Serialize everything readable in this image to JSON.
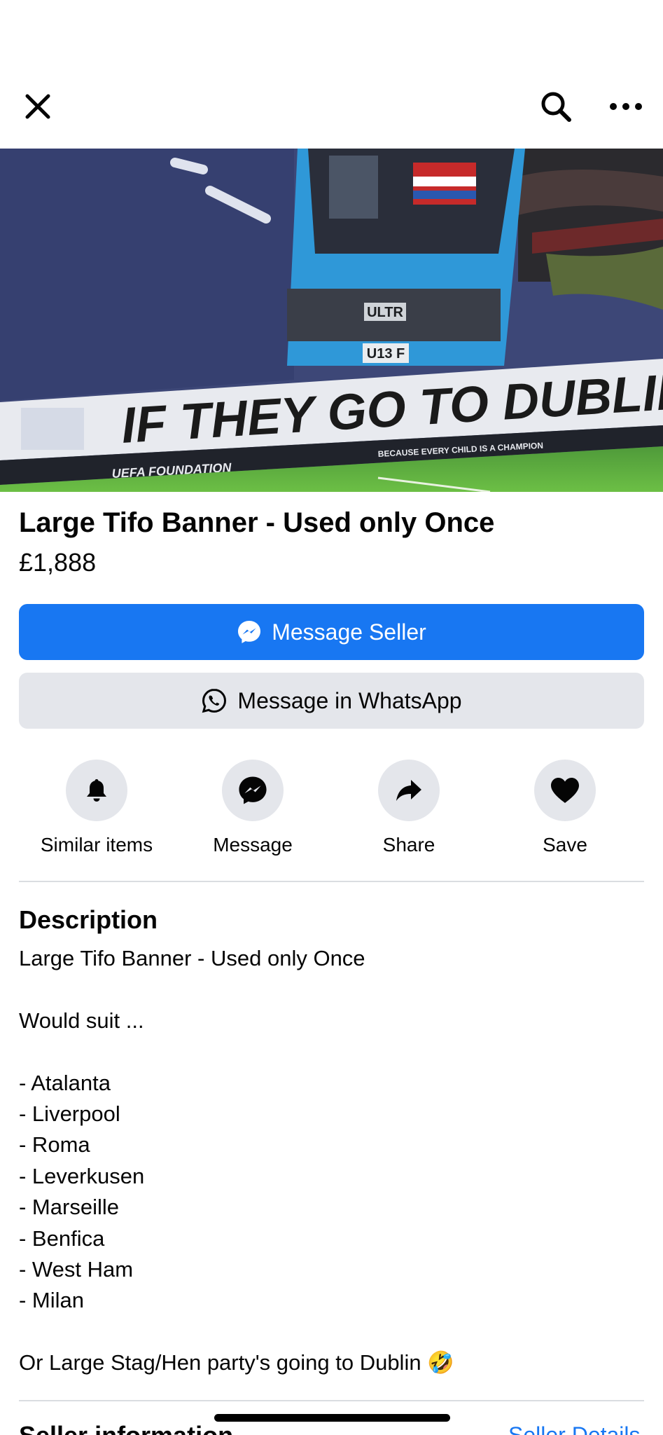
{
  "listing": {
    "title": "Large Tifo Banner - Used only Once",
    "price": "£1,888"
  },
  "image": {
    "banner_text": "IF THEY GO TO DUBLIN",
    "bus_sign": "ULTR",
    "bus_plate": "U13 F",
    "ad_board_left": "UEFA FOUNDATION",
    "ad_board_right": "BECAUSE EVERY CHILD IS A CHAMPION"
  },
  "buttons": {
    "message_seller": "Message Seller",
    "message_whatsapp": "Message in WhatsApp"
  },
  "actions": [
    {
      "label": "Similar items",
      "icon": "bell-icon"
    },
    {
      "label": "Message",
      "icon": "messenger-icon"
    },
    {
      "label": "Share",
      "icon": "share-arrow-icon"
    },
    {
      "label": "Save",
      "icon": "heart-icon"
    }
  ],
  "description": {
    "heading": "Description",
    "lines": [
      "Large Tifo Banner - Used only Once",
      "",
      "Would suit ...",
      "",
      "- Atalanta",
      "- Liverpool",
      "- Roma",
      "- Leverkusen",
      "- Marseille",
      "- Benfica",
      "- West Ham",
      "- Milan",
      "",
      "Or Large Stag/Hen party's going to Dublin 🤣"
    ]
  },
  "seller": {
    "heading": "Seller information",
    "details_link": "Seller Details"
  },
  "colors": {
    "primary": "#1877f2",
    "secondary_bg": "#e4e6eb",
    "text": "#050505",
    "divider": "#dadde1"
  }
}
